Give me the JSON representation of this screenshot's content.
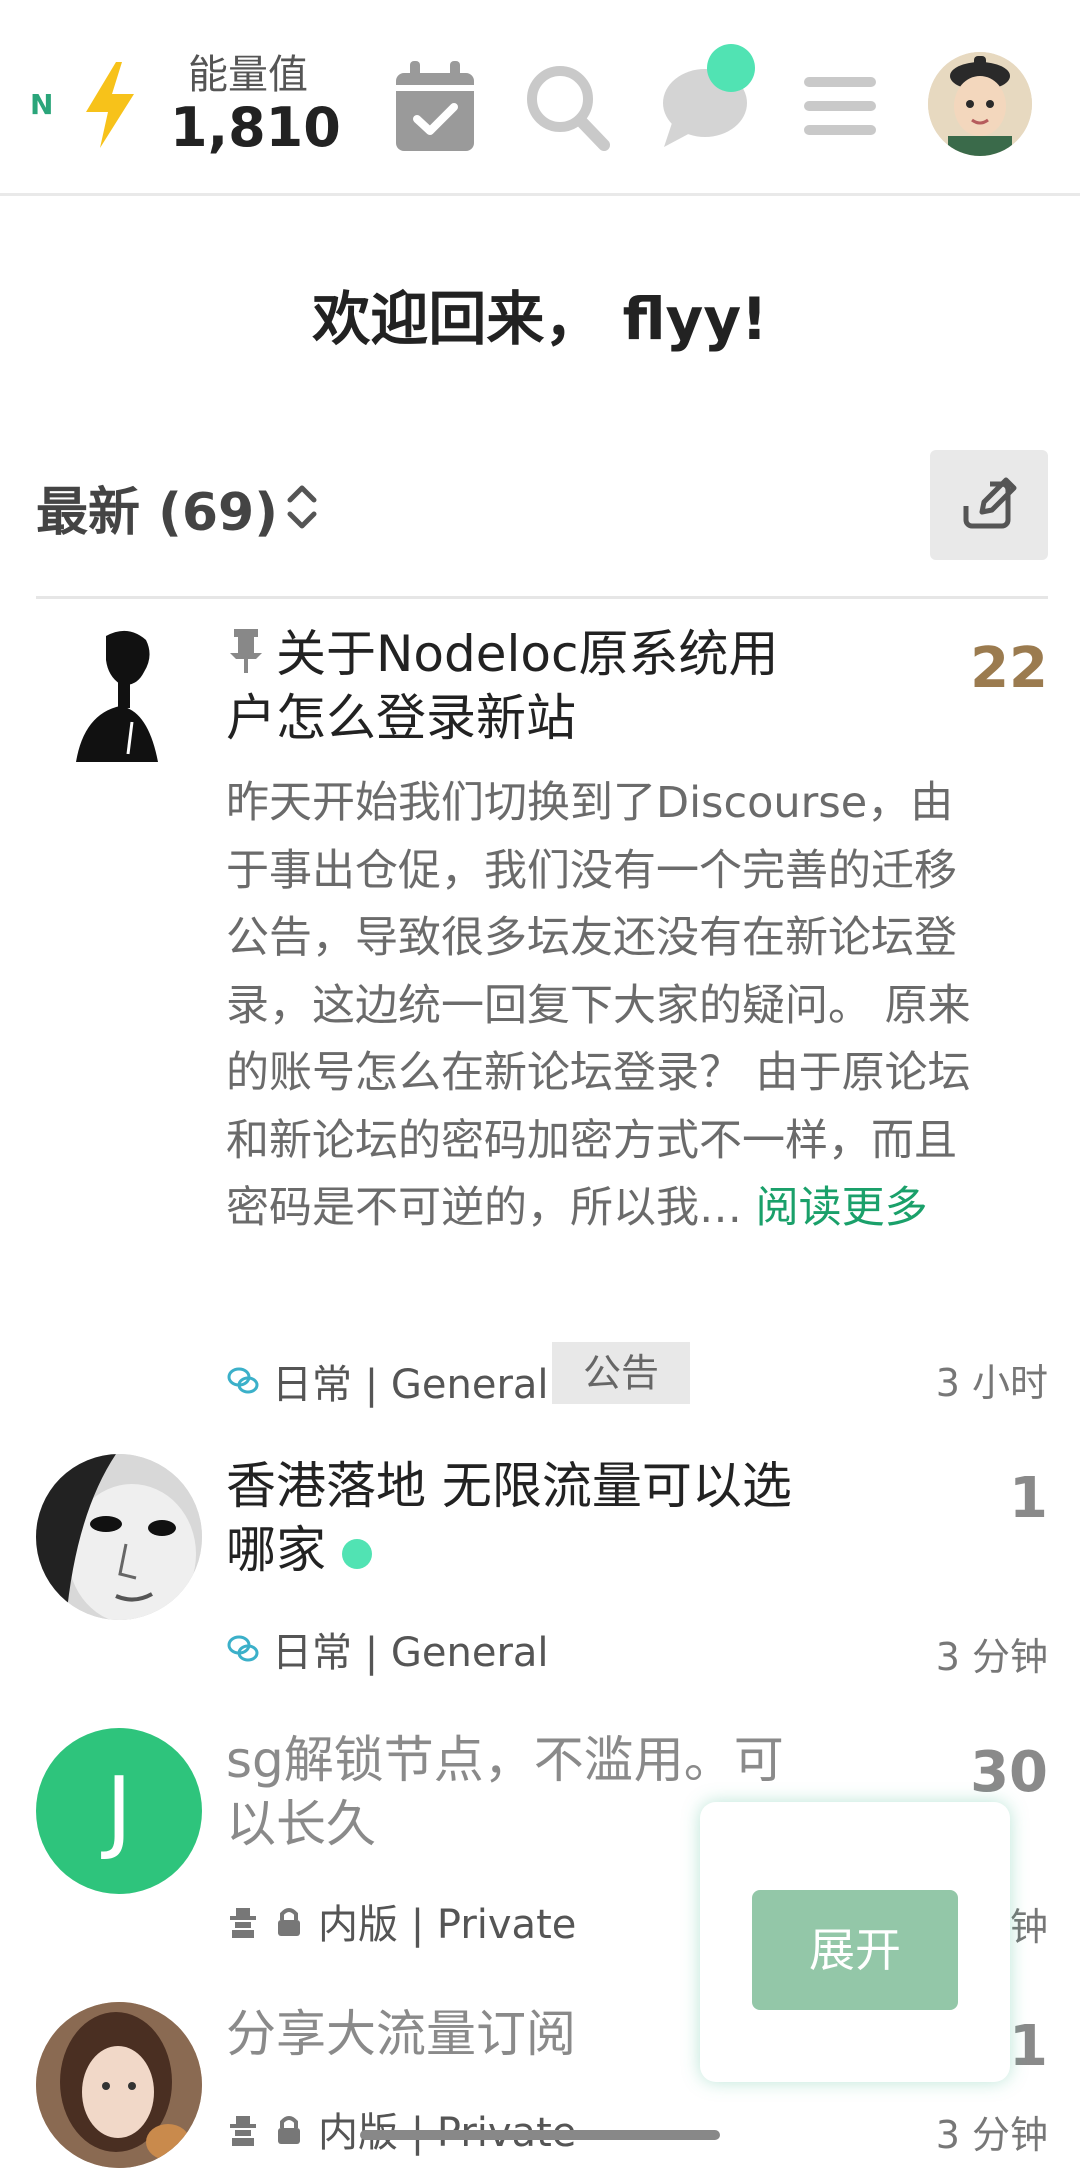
{
  "header": {
    "logo": "N",
    "energy_label": "能量值",
    "energy_value": "1,810",
    "icons": [
      "bolt-icon",
      "calendar-check-icon",
      "search-icon",
      "chat-icon",
      "menu-icon"
    ],
    "accent": "#51e3b3"
  },
  "welcome": "欢迎回来， flyy!",
  "list": {
    "filter_label": "最新 (69)"
  },
  "topics": [
    {
      "title": "关于Nodeloc原系统用户怎么登录新站",
      "title_line1": "关于Nodeloc原系统用",
      "title_line2": "户怎么登录新站",
      "pinned": true,
      "count": "22",
      "excerpt": "昨天开始我们切换到了Discourse，由于事出仓促，我们没有一个完善的迁移公告，导致很多坛友还没有在新论坛登录，这边统一回复下大家的疑问。 原来的账号怎么在新论坛登录？ 由于原论坛和新论坛的密码加密方式不一样，而且密码是不可逆的，所以我…",
      "read_more": "阅读更多",
      "category": "日常 | General",
      "tag": "公告",
      "age": "3 小时"
    },
    {
      "title_line1": "香港落地 无限流量可以选",
      "title_line2": "哪家",
      "count": "1",
      "category": "日常 | General",
      "age": "3 分钟"
    },
    {
      "avatar_letter": "J",
      "title_line1": "sg解锁节点，不滥用。可",
      "title_line2": "以长久",
      "count": "30",
      "category": "内版 | Private",
      "age": "钟"
    },
    {
      "title_line1": "分享大流量订阅",
      "count": "1",
      "category": "内版 | Private",
      "age": "3 分钟"
    }
  ],
  "popup": {
    "expand_label": "展开"
  }
}
